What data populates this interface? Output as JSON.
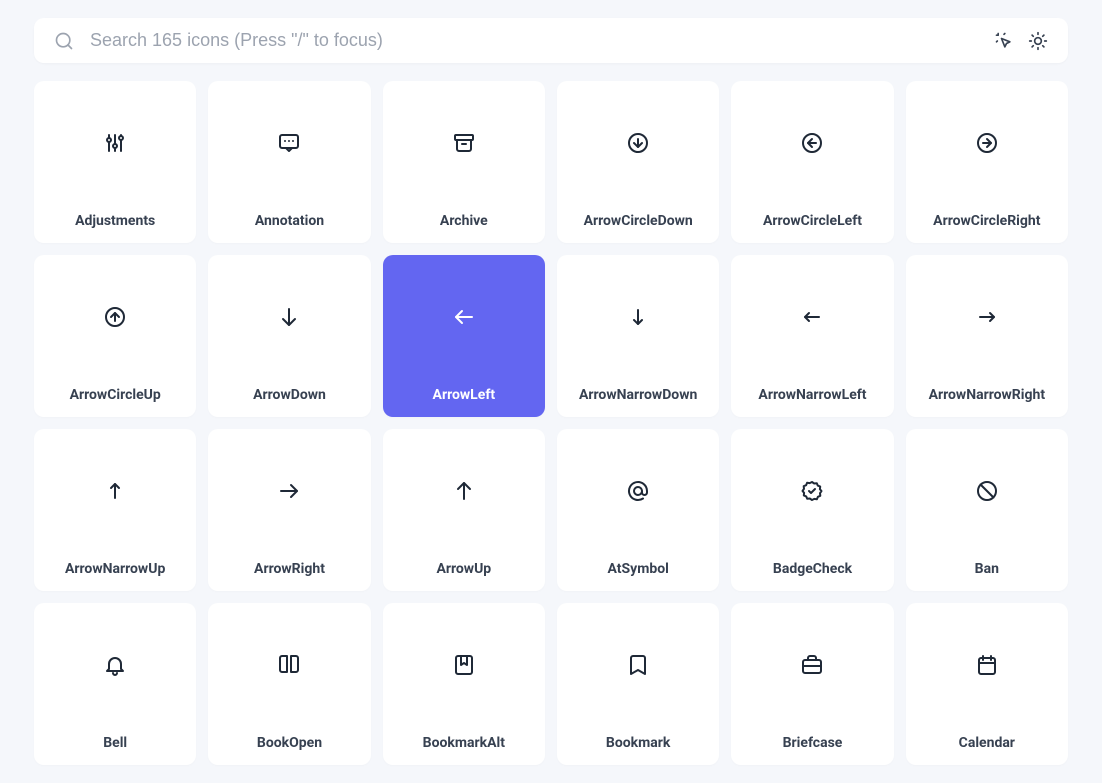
{
  "search": {
    "placeholder": "Search 165 icons (Press \"/\" to focus)"
  },
  "colors": {
    "accent": "#6366f1",
    "text": "#374151",
    "muted": "#9ca3af",
    "bg": "#f5f7fb",
    "card": "#ffffff"
  },
  "selected_index": 8,
  "icons": [
    {
      "name": "Adjustments"
    },
    {
      "name": "Annotation"
    },
    {
      "name": "Archive"
    },
    {
      "name": "ArrowCircleDown"
    },
    {
      "name": "ArrowCircleLeft"
    },
    {
      "name": "ArrowCircleRight"
    },
    {
      "name": "ArrowCircleUp"
    },
    {
      "name": "ArrowDown"
    },
    {
      "name": "ArrowLeft"
    },
    {
      "name": "ArrowNarrowDown"
    },
    {
      "name": "ArrowNarrowLeft"
    },
    {
      "name": "ArrowNarrowRight"
    },
    {
      "name": "ArrowNarrowUp"
    },
    {
      "name": "ArrowRight"
    },
    {
      "name": "ArrowUp"
    },
    {
      "name": "AtSymbol"
    },
    {
      "name": "BadgeCheck"
    },
    {
      "name": "Ban"
    },
    {
      "name": "Bell"
    },
    {
      "name": "BookOpen"
    },
    {
      "name": "BookmarkAlt"
    },
    {
      "name": "Bookmark"
    },
    {
      "name": "Briefcase"
    },
    {
      "name": "Calendar"
    }
  ]
}
